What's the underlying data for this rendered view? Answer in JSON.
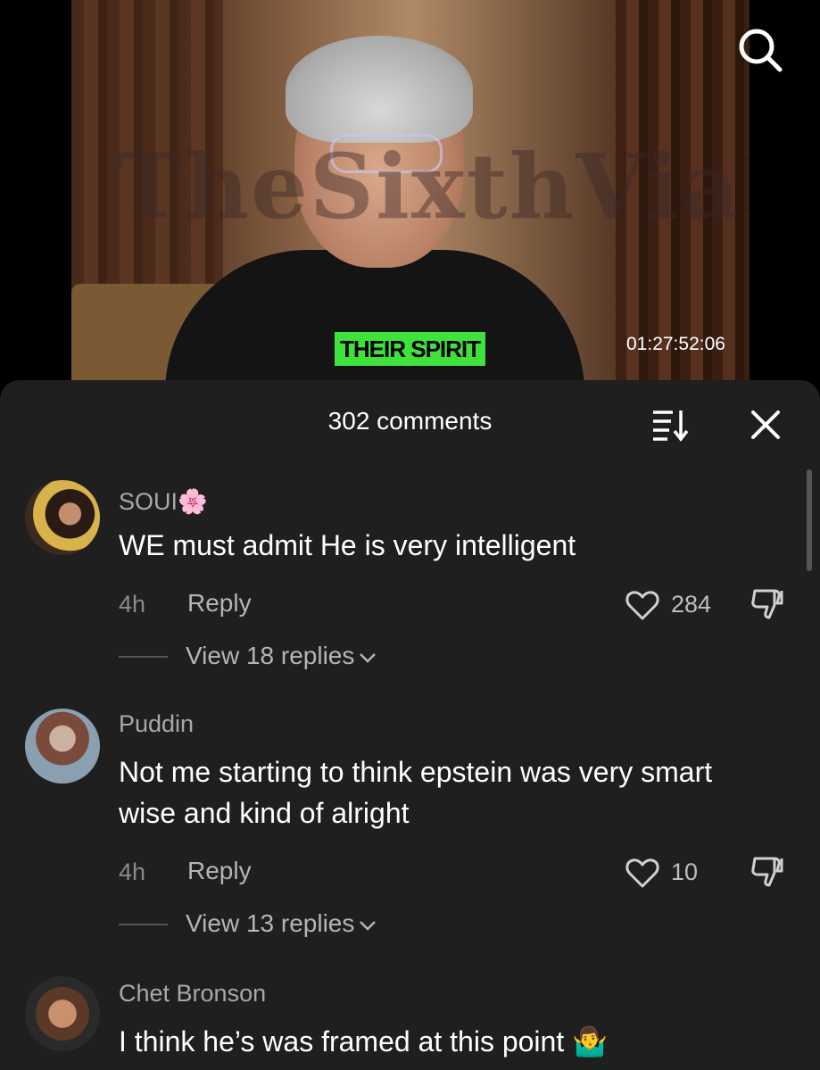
{
  "video": {
    "watermark": "TheSixthVial",
    "caption": "THEIR SPIRIT",
    "timecode": "01:27:52:06",
    "search_icon": "search-icon"
  },
  "sheet": {
    "title": "302 comments",
    "sort_icon": "sort-icon",
    "close_icon": "close-icon"
  },
  "comments": [
    {
      "username": "SOUI🌸",
      "text": "WE must admit He is very intelligent",
      "time": "4h",
      "reply": "Reply",
      "likes": "284",
      "view_replies": "View 18 replies"
    },
    {
      "username": "Puddin",
      "text": "Not me starting to think epstein was very smart wise and kind of alright",
      "time": "4h",
      "reply": "Reply",
      "likes": "10",
      "view_replies": "View 13 replies"
    },
    {
      "username": "Chet Bronson",
      "text": "I think he’s was framed at this point 🤷‍♂️"
    }
  ],
  "colors": {
    "sheet_bg": "#1f1f1f",
    "caption_bg": "#3fe23a",
    "muted_text": "#a8a8a8"
  }
}
